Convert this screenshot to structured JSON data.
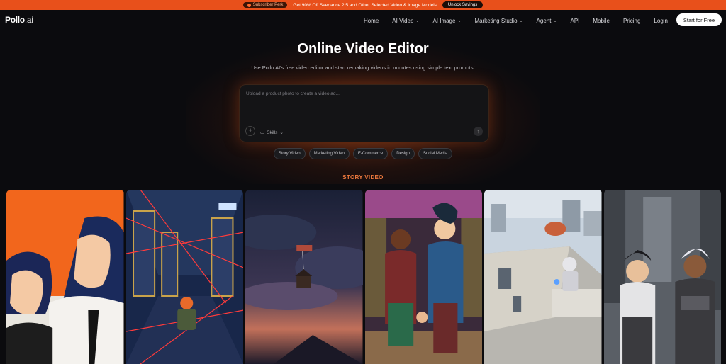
{
  "promo": {
    "badge": "Subscriber Perk",
    "message": "Get 90% Off Seedance 2.5 and Other Selected Video & Image Models",
    "cta": "Unlock Savings"
  },
  "nav": {
    "logo_main": "Pollo",
    "logo_suffix": ".ai",
    "items": [
      {
        "label": "Home",
        "dropdown": false
      },
      {
        "label": "AI Video",
        "dropdown": true
      },
      {
        "label": "AI Image",
        "dropdown": true
      },
      {
        "label": "Marketing Studio",
        "dropdown": true
      },
      {
        "label": "Agent",
        "dropdown": true
      },
      {
        "label": "API",
        "dropdown": false
      },
      {
        "label": "Mobile",
        "dropdown": false
      },
      {
        "label": "Pricing",
        "dropdown": false
      },
      {
        "label": "Login",
        "dropdown": false
      }
    ],
    "cta": "Start for Free"
  },
  "hero": {
    "title": "Online Video Editor",
    "subtitle": "Use Pollo AI's free video editor and start remaking videos in minutes using simple text prompts!"
  },
  "prompt": {
    "placeholder": "Upload a product photo to create a video ad...",
    "skills_label": "Skills"
  },
  "chips": [
    "Story Video",
    "Marketing Video",
    "E-Commerce",
    "Design",
    "Social Media"
  ],
  "section": {
    "label": "STORY VIDEO"
  },
  "gallery": [
    {
      "name": "anime-couple-card"
    },
    {
      "name": "laser-corridor-card"
    },
    {
      "name": "floating-house-card"
    },
    {
      "name": "store-duo-card"
    },
    {
      "name": "rooftop-robot-card"
    },
    {
      "name": "city-heroes-card"
    }
  ]
}
